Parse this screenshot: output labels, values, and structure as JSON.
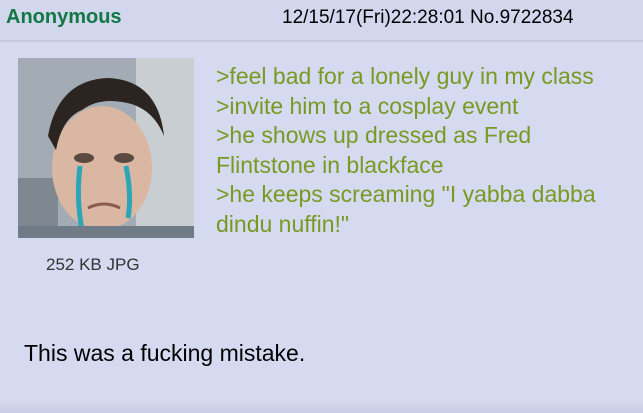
{
  "post": {
    "name": "Anonymous",
    "datetime": "12/15/17(Fri)22:28:01",
    "post_number": "No.9722834",
    "file": {
      "info": "252 KB JPG",
      "thumbnail": "crying-person-thumbnail"
    },
    "greentext": [
      ">feel bad for a lonely guy in my class",
      ">invite him to a cosplay event",
      ">he shows up dressed as Fred Flintstone in blackface",
      ">he keeps screaming \"I yabba dabba dindu nuffin!\""
    ],
    "comment": "This was a fucking mistake."
  },
  "colors": {
    "post_background": "#d6daf0",
    "name": "#117743",
    "greentext": "#789922"
  }
}
